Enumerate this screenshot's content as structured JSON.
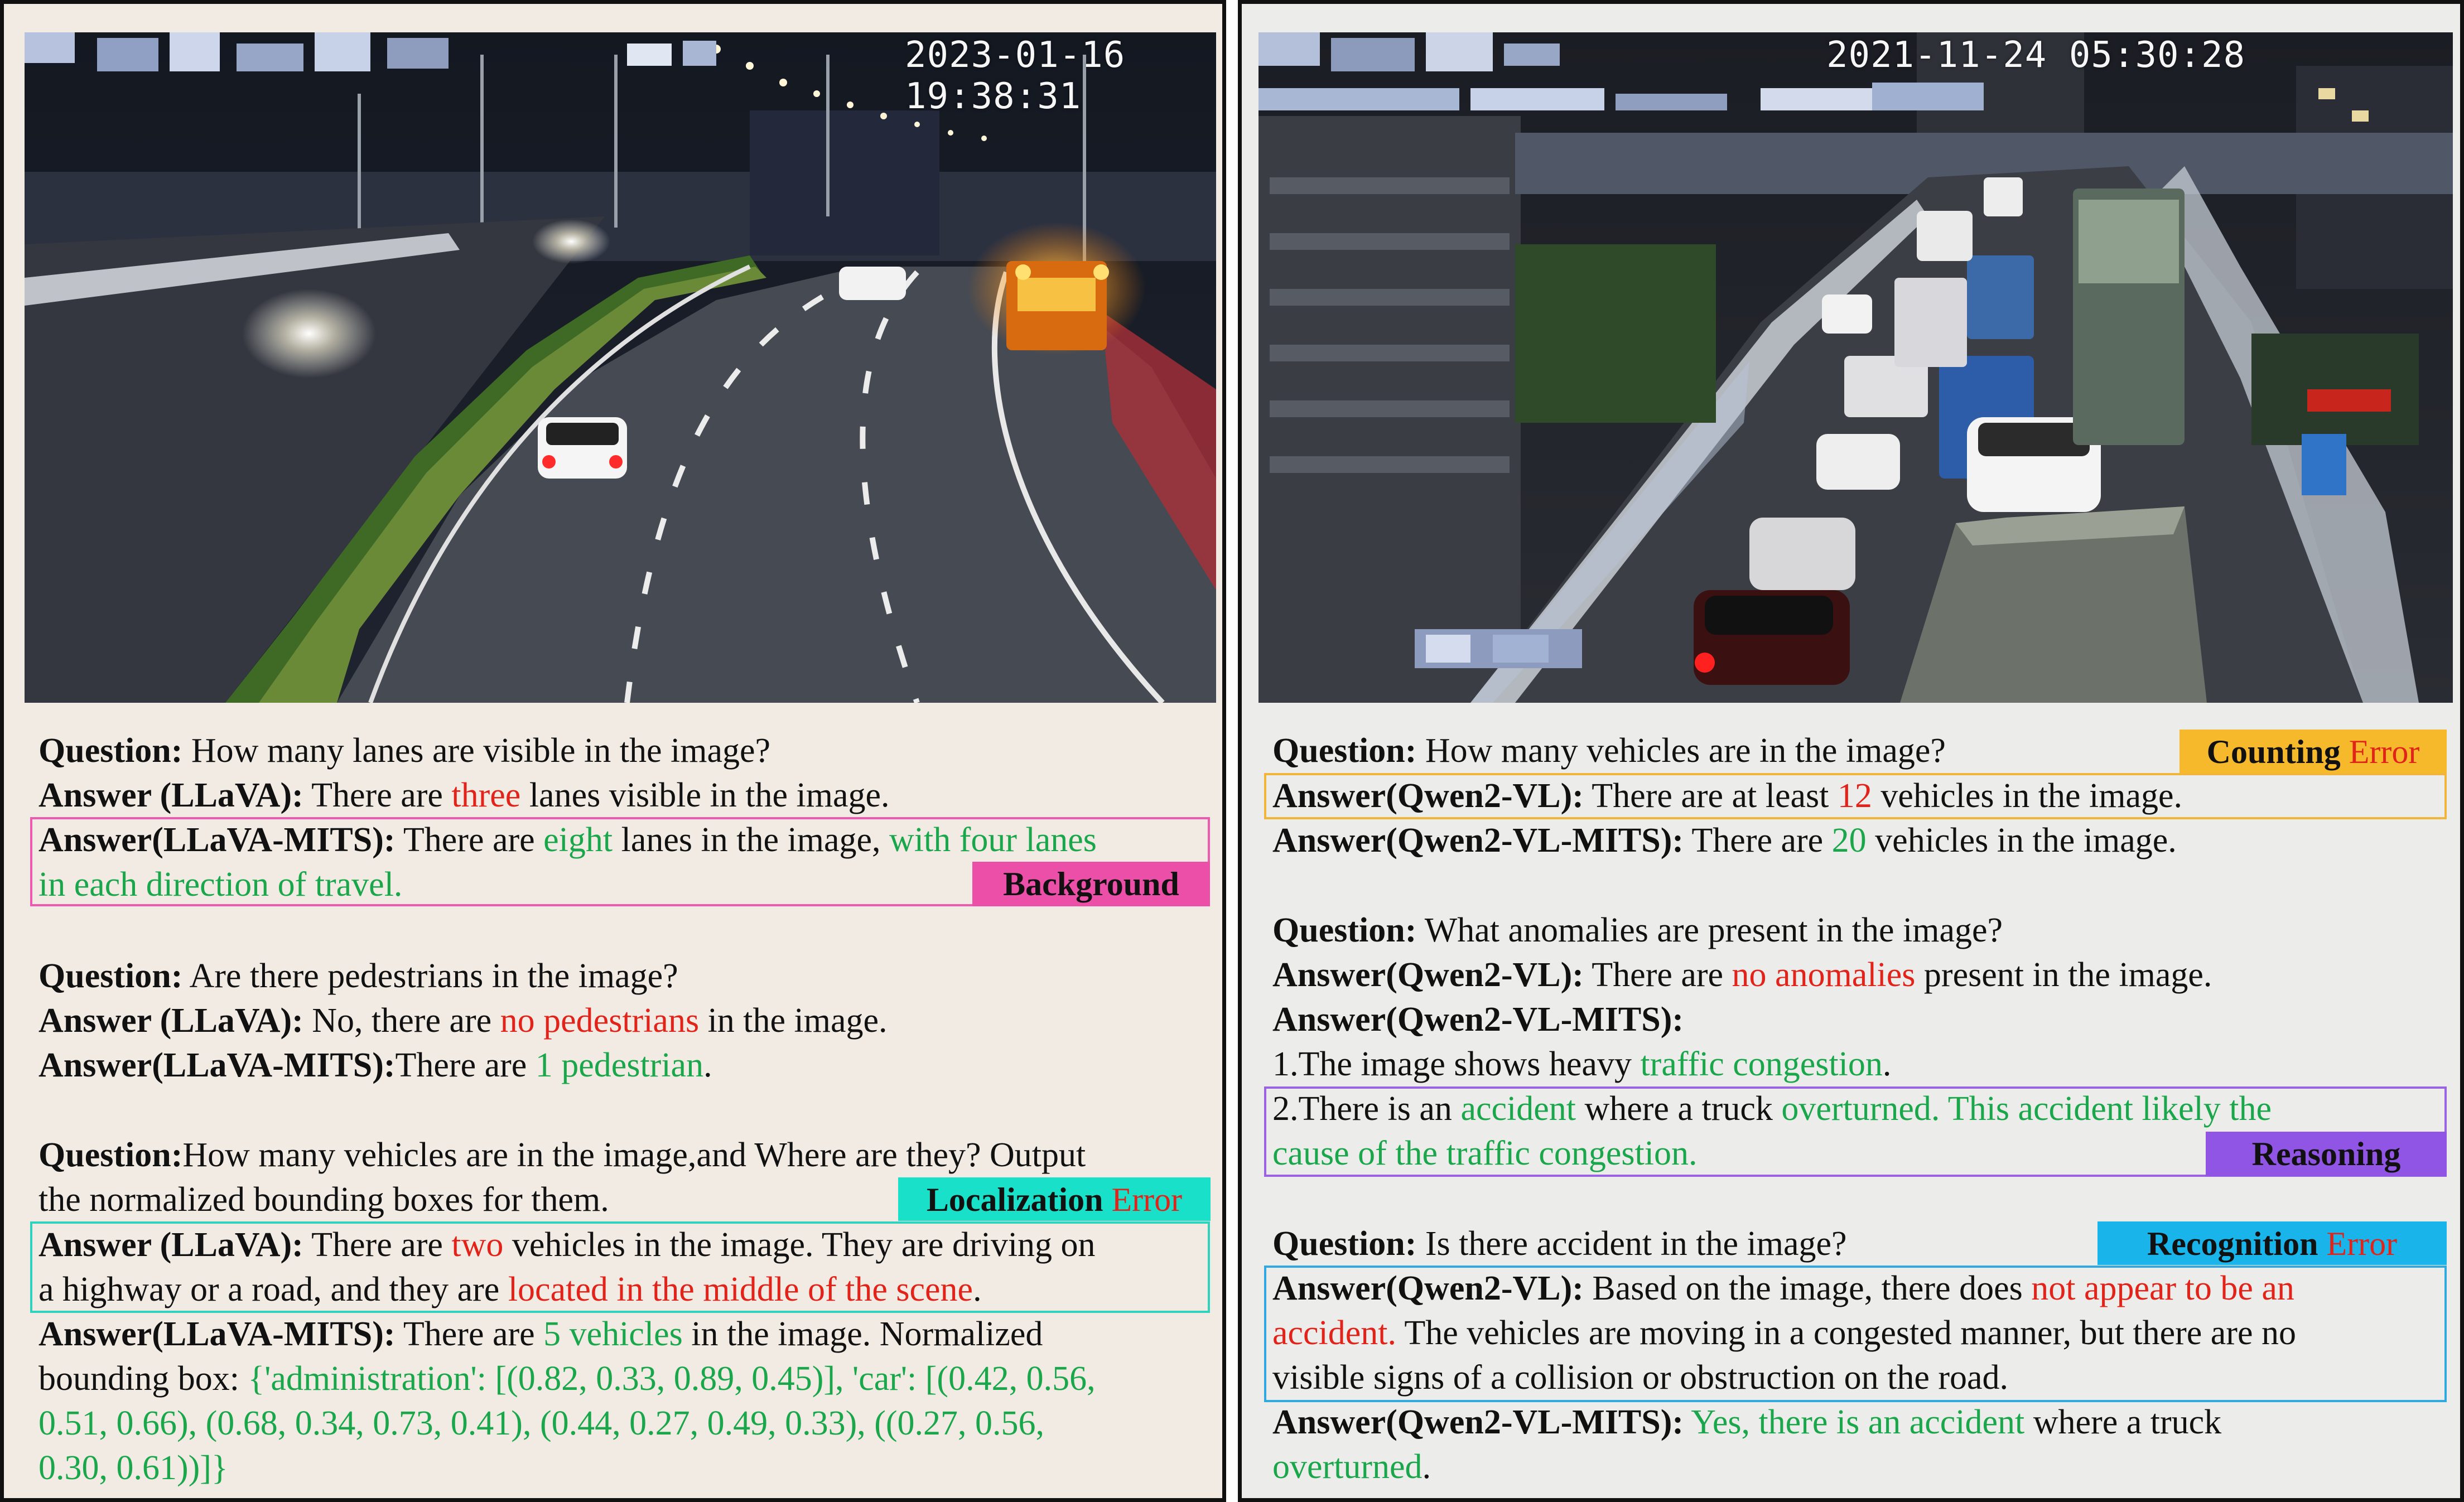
{
  "left": {
    "timestamp": "2023-01-16 19:38:31",
    "q1": {
      "question_label": "Question:",
      "question": " How many lanes are visible in the image?",
      "a1_label": "Answer (LLaVA):",
      "a1_pre": " There are ",
      "a1_red": "three",
      "a1_post": " lanes visible in the image.",
      "a2_label": "Answer(LLaVA-MITS):",
      "a2_pre": " There are ",
      "a2_green1": "eight",
      "a2_mid": " lanes in the image, ",
      "a2_green2": "with four lanes",
      "a2_line2": "in each direction of travel.",
      "tag": "Background"
    },
    "q2": {
      "question_label": "Question:",
      "question": " Are there pedestrians in the image?",
      "a1_label": "Answer (LLaVA):",
      "a1_pre": " No, there are ",
      "a1_red": "no pedestrians",
      "a1_post": " in the image.",
      "a2_label": "Answer(LLaVA-MITS):",
      "a2_pre": "There are ",
      "a2_green": "1 pedestrian",
      "a2_post": "."
    },
    "q3": {
      "question_label": "Question:",
      "question": "How many vehicles are in the image,and Where are they? Output",
      "question_line2": "the normalized bounding boxes for them.",
      "tag_main": "Localization ",
      "tag_err": "Error",
      "a1_label": "Answer (LLaVA):",
      "a1_pre": " There are ",
      "a1_red1": "two",
      "a1_post": " vehicles in the image. They are driving on",
      "a1_line2_pre": "a highway or a road, and they are ",
      "a1_red2": "located in the middle of the scene",
      "a1_line2_post": ".",
      "a2_label": "Answer(LLaVA-MITS):",
      "a2_pre": " There are ",
      "a2_green": "5 vehicles",
      "a2_post": " in the image. Normalized",
      "a2_line2_pre": "bounding box: ",
      "a2_line2_green": "{'administration': [(0.82, 0.33, 0.89, 0.45)], 'car': [(0.42, 0.56,",
      "a2_line3": "0.51, 0.66), (0.68, 0.34, 0.73, 0.41), (0.44, 0.27, 0.49, 0.33), ((0.27, 0.56,",
      "a2_line4": "0.30, 0.61))]}"
    }
  },
  "right": {
    "timestamp": "2021-11-24 05:30:28",
    "q1": {
      "question_label": "Question:",
      "question": "  How many vehicles are in the image?",
      "tag_main": "Counting ",
      "tag_err": "Error",
      "a1_label": "Answer(Qwen2-VL):",
      "a1_pre": " There are at least ",
      "a1_red": "12",
      "a1_post": " vehicles in the image.",
      "a2_label": "Answer(Qwen2-VL-MITS):",
      "a2_pre": " There are ",
      "a2_green": "20",
      "a2_post": " vehicles in the image."
    },
    "q2": {
      "question_label": "Question:",
      "question": " What anomalies are present in the image?",
      "a1_label": "Answer(Qwen2-VL):",
      "a1_pre": " There are ",
      "a1_red": "no anomalies",
      "a1_post": " present in the image.",
      "a2_label": "Answer(Qwen2-VL-MITS):",
      "l1_pre": "1.The image shows heavy ",
      "l1_green": "traffic congestion",
      "l1_post": ".",
      "l2_pre": "2.There is an ",
      "l2_green1": "accident",
      "l2_mid": " where a truck ",
      "l2_green2": "overturned",
      "l2_green3": ". This accident likely the",
      "l3_green": "cause of the traffic congestion.",
      "tag": "Reasoning"
    },
    "q3": {
      "question_label": "Question:",
      "question": " Is there accident in the image?",
      "tag_main": "Recognition ",
      "tag_err": "Error",
      "a1_label": "Answer(Qwen2-VL):",
      "a1_pre": " Based on the image, there does ",
      "a1_red1": "not appear to be an",
      "a1_line2_red": "accident.",
      "a1_line2_post": " The vehicles are moving in a congested manner, but there are no",
      "a1_line3": "visible signs of a collision or obstruction on the road.",
      "a2_label": "Answer(Qwen2-VL-MITS):",
      "a2_green": " Yes, there is an accident",
      "a2_post": " where a truck",
      "a2_line2_green": "overturned",
      "a2_line2_post": "."
    }
  },
  "colors": {
    "answer_red": "#e2231a",
    "answer_green": "#1aa64a",
    "background_tag": "#ec4fa8",
    "localization_tag": "#19e0c8",
    "counting_tag": "#f7b92c",
    "reasoning_tag": "#9055e5",
    "recognition_tag": "#19b4ea"
  }
}
